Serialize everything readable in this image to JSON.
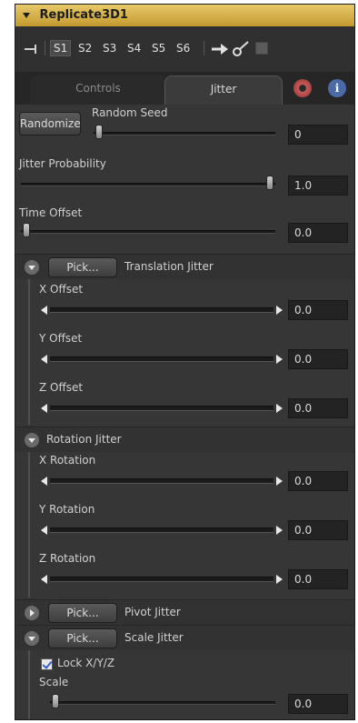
{
  "title": "Replicate3D1",
  "slots": [
    "S1",
    "S2",
    "S3",
    "S4",
    "S5",
    "S6"
  ],
  "active_slot": "S1",
  "tabs": {
    "controls": "Controls",
    "jitter": "Jitter"
  },
  "icons": {
    "gear": "gear-icon",
    "info": "info-icon",
    "info_glyph": "i"
  },
  "randomize_label": "Randomize",
  "random_seed": {
    "label": "Random Seed",
    "value": "0"
  },
  "jitter_probability": {
    "label": "Jitter Probability",
    "value": "1.0"
  },
  "time_offset": {
    "label": "Time Offset",
    "value": "0.0"
  },
  "translation": {
    "pick_label": "Pick...",
    "label": "Translation Jitter",
    "x": {
      "label": "X Offset",
      "value": "0.0"
    },
    "y": {
      "label": "Y Offset",
      "value": "0.0"
    },
    "z": {
      "label": "Z Offset",
      "value": "0.0"
    }
  },
  "rotation": {
    "label": "Rotation Jitter",
    "x": {
      "label": "X Rotation",
      "value": "0.0"
    },
    "y": {
      "label": "Y Rotation",
      "value": "0.0"
    },
    "z": {
      "label": "Z Rotation",
      "value": "0.0"
    }
  },
  "pivot": {
    "pick_label": "Pick...",
    "label": "Pivot Jitter"
  },
  "scale": {
    "pick_label": "Pick...",
    "label": "Scale Jitter",
    "lock_label": "Lock X/Y/Z",
    "scale_label": "Scale",
    "value": "0.0"
  }
}
